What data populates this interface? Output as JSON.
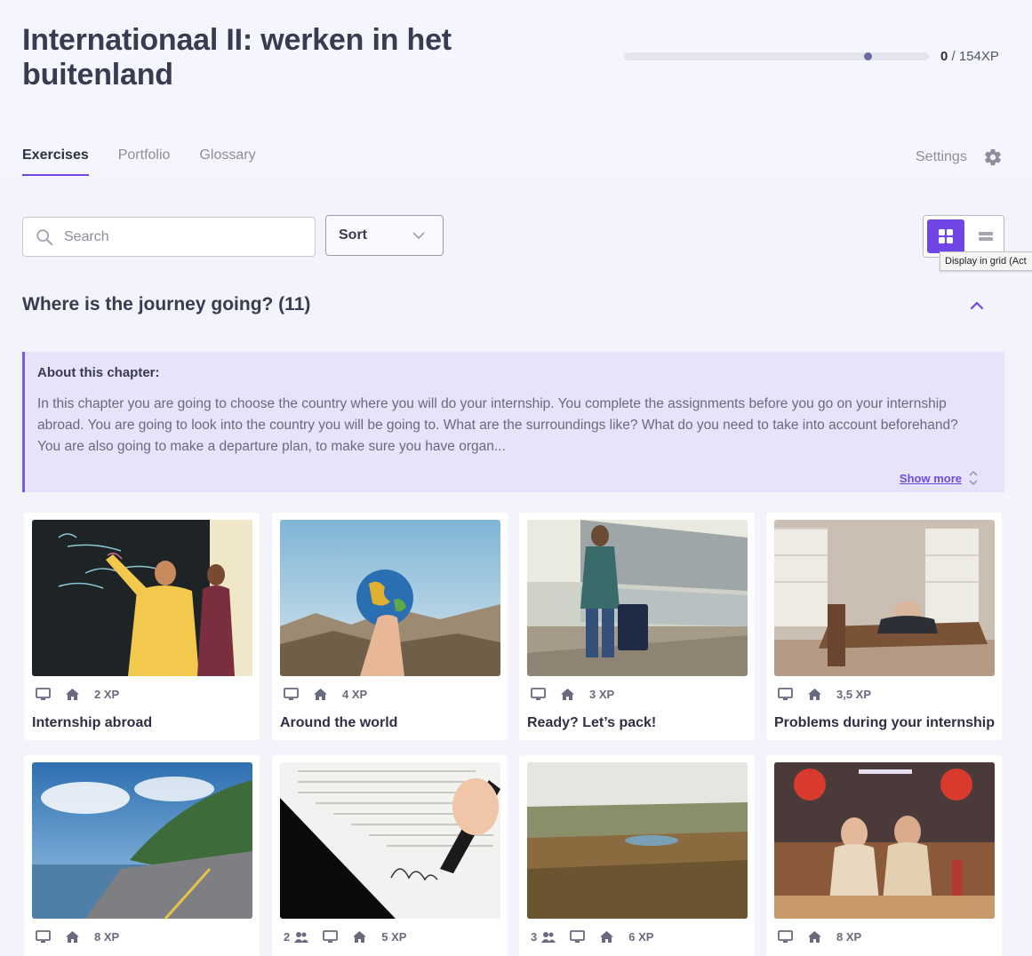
{
  "course": {
    "title": "Internationaal II: werken in het buitenland",
    "xp_earned": "0",
    "xp_total": "/ 154XP",
    "progress_fraction": 0
  },
  "tabs": [
    {
      "label": "Exercises",
      "active": true
    },
    {
      "label": "Portfolio",
      "active": false
    },
    {
      "label": "Glossary",
      "active": false
    }
  ],
  "settings_label": "Settings",
  "toolbar": {
    "search_placeholder": "Search",
    "sort_label": "Sort",
    "grid_tooltip": "Display in grid (Act"
  },
  "chapter": {
    "title": "Where is the journey going? (11)",
    "about_title": "About this chapter:",
    "about_text": "In this chapter you are going to choose the country where you will do your internship. You complete the assignments before you go on your internship abroad. You are going to look into the country you will be going to. What are the surroundings like? What do you need to take into account beforehand? You are also going to make a departure plan, to make sure you have organ...",
    "show_more": "Show more"
  },
  "cards": [
    {
      "title": "Internship abroad",
      "xp": "2 XP",
      "people": "",
      "scene": "classroom"
    },
    {
      "title": "Around the world",
      "xp": "4 XP",
      "people": "",
      "scene": "globe"
    },
    {
      "title": "Ready? Let’s pack!",
      "xp": "3 XP",
      "people": "",
      "scene": "travel"
    },
    {
      "title": "Problems during your internship",
      "xp": "3,5 XP",
      "people": "",
      "scene": "room"
    },
    {
      "title": "",
      "xp": "8 XP",
      "people": "",
      "scene": "coast"
    },
    {
      "title": "",
      "xp": "5 XP",
      "people": "2",
      "scene": "signing"
    },
    {
      "title": "",
      "xp": "6 XP",
      "people": "3",
      "scene": "landscape"
    },
    {
      "title": "",
      "xp": "8 XP",
      "people": "",
      "scene": "restaurant"
    }
  ],
  "colors": {
    "accent": "#7046e6",
    "about_bg": "#e6e3fb",
    "page_bg": "#f3f3fb"
  }
}
